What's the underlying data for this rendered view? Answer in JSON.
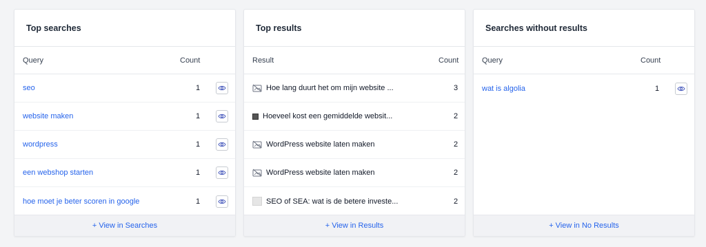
{
  "top_searches": {
    "title": "Top searches",
    "col_query": "Query",
    "col_count": "Count",
    "rows": [
      {
        "query": "seo",
        "count": "1"
      },
      {
        "query": "website maken",
        "count": "1"
      },
      {
        "query": "wordpress",
        "count": "1"
      },
      {
        "query": "een webshop starten",
        "count": "1"
      },
      {
        "query": "hoe moet je beter scoren in google",
        "count": "1"
      }
    ],
    "footer": "+ View in Searches"
  },
  "top_results": {
    "title": "Top results",
    "col_result": "Result",
    "col_count": "Count",
    "rows": [
      {
        "icon": "image-off-icon",
        "result": "Hoe lang duurt het om mijn website ...",
        "count": "3"
      },
      {
        "icon": "thumbnail-image",
        "result": "Hoeveel kost een gemiddelde websit...",
        "count": "2"
      },
      {
        "icon": "image-off-icon",
        "result": "WordPress website laten maken",
        "count": "2"
      },
      {
        "icon": "image-off-icon",
        "result": "WordPress website laten maken",
        "count": "2"
      },
      {
        "icon": "thumbnail-light",
        "result": "SEO of SEA: wat is de betere investe...",
        "count": "2"
      }
    ],
    "footer": "+ View in Results"
  },
  "no_results": {
    "title": "Searches without results",
    "col_query": "Query",
    "col_count": "Count",
    "rows": [
      {
        "query": "wat is algolia",
        "count": "1"
      }
    ],
    "footer": "+ View in No Results"
  },
  "colors": {
    "link": "#2563eb",
    "border": "#e5e7eb",
    "footer_bg": "#f1f2f5",
    "page_bg": "#f3f4f6"
  }
}
